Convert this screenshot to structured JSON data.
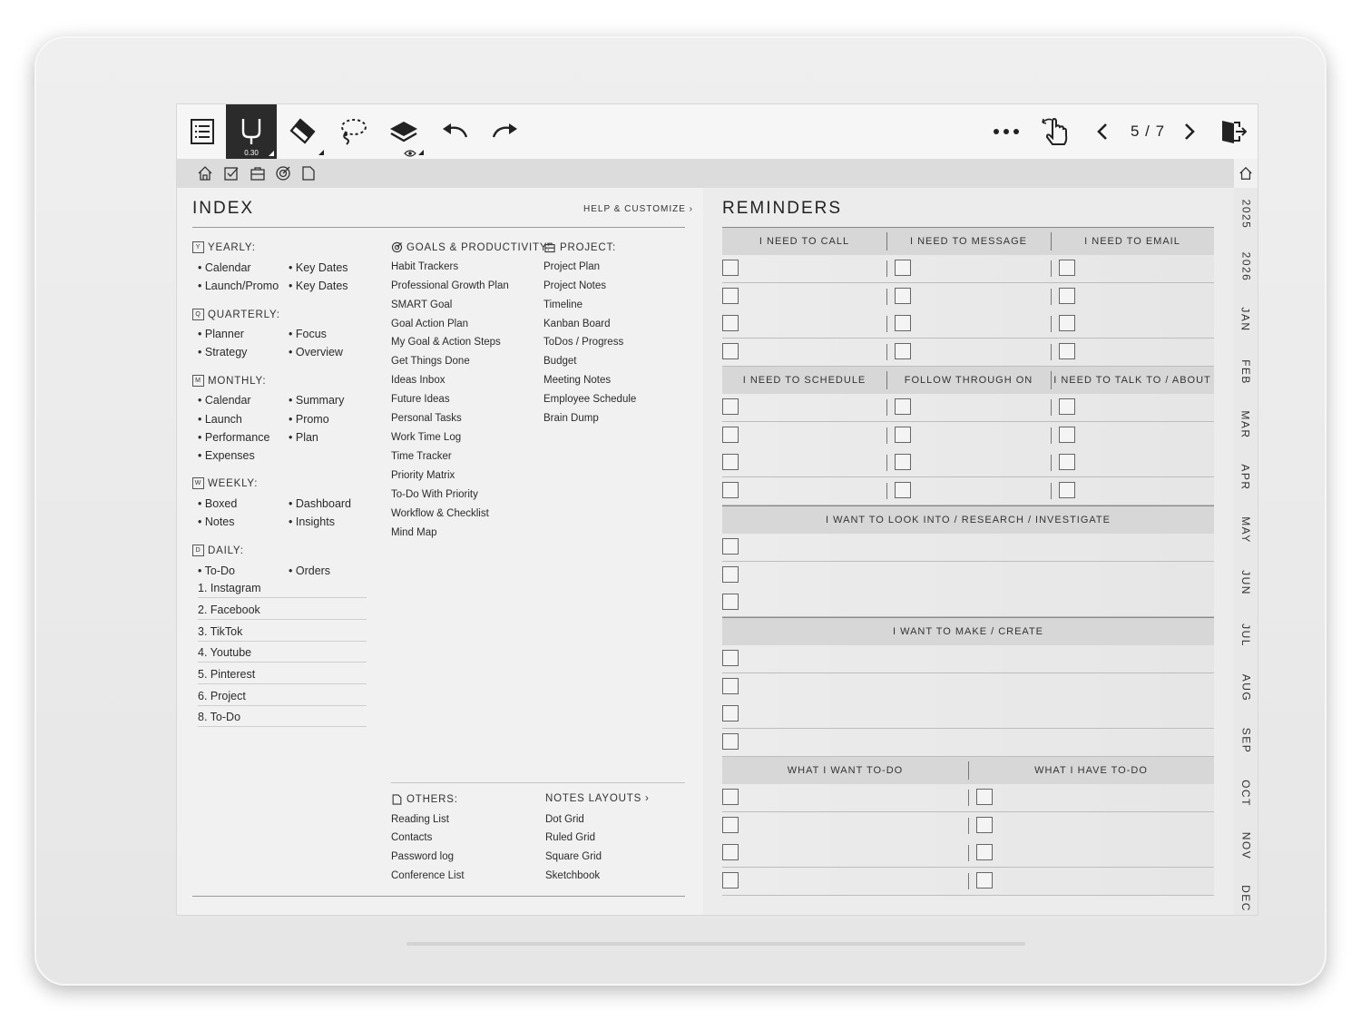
{
  "toolbar": {
    "pen_size": "0.30",
    "page_indicator": "5 / 7",
    "icons": [
      "menu-icon",
      "pen-icon",
      "eraser-icon",
      "lasso-icon",
      "layers-icon",
      "undo-icon",
      "redo-icon",
      "more-icon",
      "touch-icon",
      "prev-page-icon",
      "next-page-icon",
      "exit-icon"
    ]
  },
  "subbar": {
    "icons": [
      "home-icon",
      "checkbox-icon",
      "briefcase-icon",
      "goal-icon",
      "note-icon"
    ]
  },
  "side_tabs": [
    "2025",
    "2026",
    "JAN",
    "FEB",
    "MAR",
    "APR",
    "MAY",
    "JUN",
    "JUL",
    "AUG",
    "SEP",
    "OCT",
    "NOV",
    "DEC"
  ],
  "index": {
    "title": "INDEX",
    "help": "HELP & CUSTOMIZE",
    "yearly": {
      "label": "YEARLY:",
      "badge": "Y",
      "col1": [
        "Calendar",
        "Launch/Promo"
      ],
      "col2": [
        "Key Dates",
        "Key Dates"
      ]
    },
    "quarterly": {
      "label": "QUARTERLY:",
      "badge": "Q",
      "col1": [
        "Planner",
        "Strategy"
      ],
      "col2": [
        "Focus",
        "Overview"
      ]
    },
    "monthly": {
      "label": "MONTHLY:",
      "badge": "M",
      "col1": [
        "Calendar",
        "Launch",
        "Performance",
        "Expenses"
      ],
      "col2": [
        "Summary",
        "Promo",
        "Plan"
      ]
    },
    "weekly": {
      "label": "WEEKLY:",
      "badge": "W",
      "col1": [
        "Boxed",
        "Notes"
      ],
      "col2": [
        "Dashboard",
        "Insights"
      ]
    },
    "daily": {
      "label": "DAILY:",
      "badge": "D",
      "col1": [
        "To-Do"
      ],
      "col2": [
        "Orders"
      ],
      "numbered": [
        "1. Instagram",
        "2. Facebook",
        "3. TikTok",
        "4. Youtube",
        "5. Pinterest",
        "6. Project",
        "8. To-Do"
      ]
    },
    "goals": {
      "label": "GOALS & PRODUCTIVITY:",
      "items": [
        "Habit Trackers",
        "Professional Growth Plan",
        "SMART Goal",
        "Goal Action Plan",
        "My Goal & Action Steps",
        "Get Things Done",
        "Ideas Inbox",
        "Future Ideas",
        "Personal Tasks",
        "Work Time Log",
        "Time Tracker",
        "Priority Matrix",
        "To-Do With Priority",
        "Workflow & Checklist",
        "Mind Map"
      ]
    },
    "project": {
      "label": "PROJECT:",
      "items": [
        "Project Plan",
        "Project Notes",
        "Timeline",
        "Kanban Board",
        "ToDos / Progress",
        "Budget",
        "Meeting Notes",
        "Employee Schedule",
        "Brain Dump"
      ]
    },
    "others": {
      "label": "OTHERS:",
      "items": [
        "Reading List",
        "Contacts",
        "Password log",
        "Conference List"
      ]
    },
    "notes_layouts": {
      "label": "NOTES LAYOUTS",
      "items": [
        "Dot Grid",
        "Ruled Grid",
        "Square Grid",
        "Sketchbook"
      ]
    }
  },
  "reminders": {
    "title": "REMINDERS",
    "row1_heads": [
      "I NEED TO CALL",
      "I NEED TO MESSAGE",
      "I NEED TO EMAIL"
    ],
    "row2_heads": [
      "I NEED TO SCHEDULE",
      "FOLLOW THROUGH ON",
      "I NEED TO TALK TO / ABOUT"
    ],
    "research_head": "I WANT TO LOOK INTO / RESEARCH / INVESTIGATE",
    "make_head": "I WANT TO MAKE / CREATE",
    "todo_heads": [
      "WHAT I WANT TO-DO",
      "WHAT I HAVE TO-DO"
    ]
  }
}
